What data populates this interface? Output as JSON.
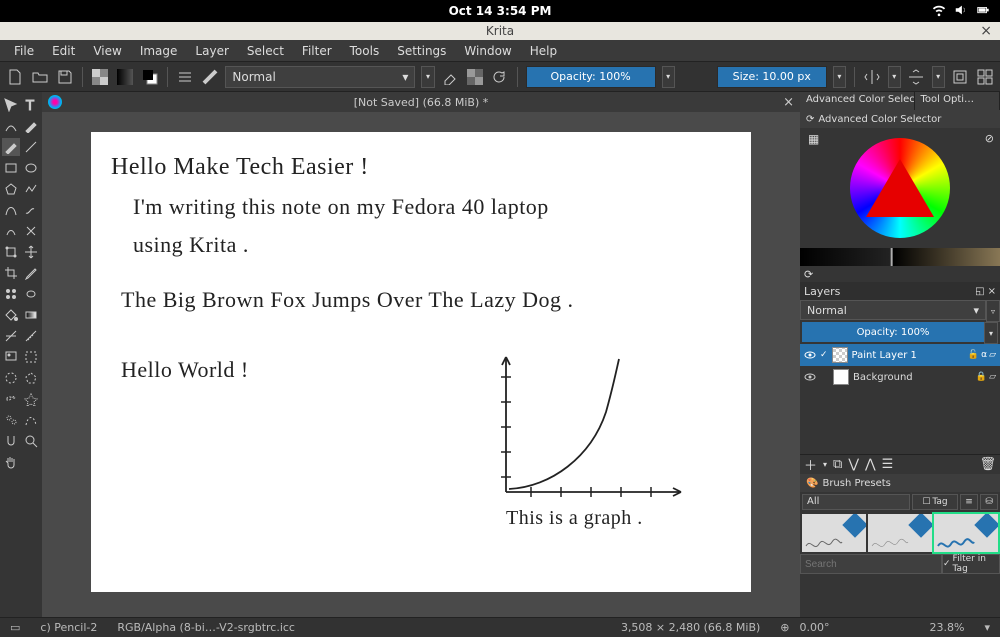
{
  "os": {
    "datetime": "Oct 14   3:54 PM"
  },
  "window": {
    "title": "Krita"
  },
  "menu": [
    "File",
    "Edit",
    "View",
    "Image",
    "Layer",
    "Select",
    "Filter",
    "Tools",
    "Settings",
    "Window",
    "Help"
  ],
  "toolbar": {
    "blend_mode": "Normal",
    "opacity_label": "Opacity: 100%",
    "size_label": "Size: 10.00 px"
  },
  "document": {
    "tab_title": "[Not Saved]  (66.8 MiB) *",
    "handwriting": {
      "line1": "Hello Make Tech Easier !",
      "line2": "I'm writing this note on my Fedora 40 laptop",
      "line3": "using Krita .",
      "line4": "The Big Brown Fox Jumps Over The Lazy Dog .",
      "line5": "Hello World !",
      "graph_caption": "This is a graph ."
    }
  },
  "color_panel": {
    "tab1": "Advanced Color Selec…",
    "tab2": "Tool Opti…",
    "subtitle": "Advanced Color Selector"
  },
  "layers": {
    "title": "Layers",
    "blend_mode": "Normal",
    "opacity_label": "Opacity:  100%",
    "rows": [
      {
        "name": "Paint Layer 1",
        "active": true
      },
      {
        "name": "Background",
        "active": false
      }
    ]
  },
  "presets": {
    "title": "Brush Presets",
    "filter": "All",
    "tag_label": "Tag",
    "search_placeholder": "Search",
    "filter_in_tag": "Filter in Tag"
  },
  "status": {
    "brush": "c) Pencil-2",
    "profile": "RGB/Alpha (8-bi…-V2-srgbtrc.icc",
    "dims": "3,508 × 2,480 (66.8 MiB)",
    "rotation": "0.00°",
    "zoom": "23.8%"
  }
}
